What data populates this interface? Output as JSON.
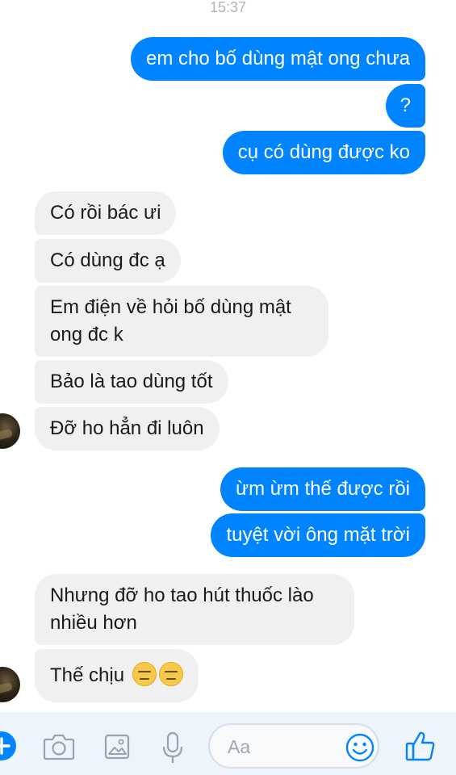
{
  "status_time": "15:37",
  "messages": [
    {
      "dir": "out",
      "text": "em cho bố dùng mật ong chưa"
    },
    {
      "dir": "out",
      "text": "?"
    },
    {
      "dir": "out",
      "text": "cụ có dùng được ko"
    },
    {
      "dir": "in",
      "text": "Có rồi bác ưi"
    },
    {
      "dir": "in",
      "text": "Có dùng đc ạ"
    },
    {
      "dir": "in",
      "text": "Em điện về hỏi bố dùng mật ong đc k"
    },
    {
      "dir": "in",
      "text": "Bảo là tao dùng tốt"
    },
    {
      "dir": "in",
      "text": "Đỡ ho hẳn đi luôn"
    },
    {
      "dir": "out",
      "text": "ừm ừm thế được rồi"
    },
    {
      "dir": "out",
      "text": "tuyệt vời ông mặt trời"
    },
    {
      "dir": "in",
      "text": "Nhưng đỡ ho tao hút thuốc lào nhiều hơn"
    },
    {
      "dir": "in",
      "text": "Thế chịu",
      "emojis": [
        "expressionless-face",
        "expressionless-face"
      ]
    }
  ],
  "composer": {
    "placeholder": "Aa",
    "icons": [
      "plus-icon",
      "camera-icon",
      "image-icon",
      "microphone-icon",
      "emoji-icon",
      "thumbs-up-icon"
    ]
  },
  "colors": {
    "outgoing_bubble": "#0084ff",
    "incoming_bubble": "#f1f0f0",
    "accent": "#0084ff"
  }
}
